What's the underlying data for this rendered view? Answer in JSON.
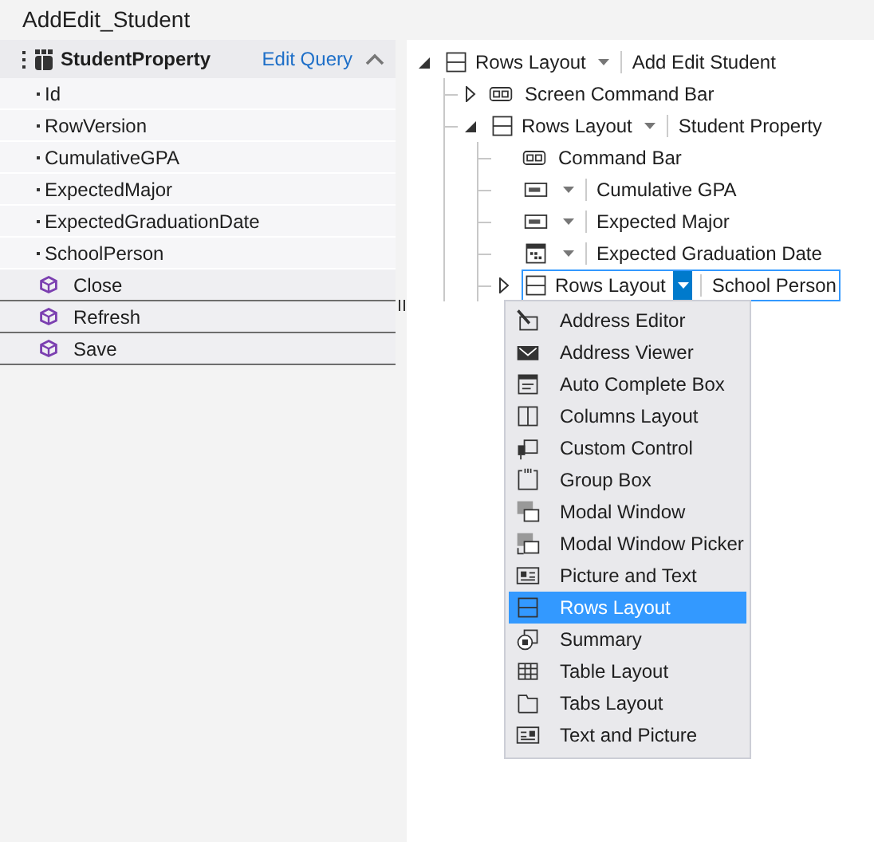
{
  "window": {
    "title": "AddEdit_Student"
  },
  "data_panel": {
    "title": "StudentProperty",
    "link": "Edit Query",
    "expanded": true,
    "properties": [
      "Id",
      "RowVersion",
      "CumulativeGPA",
      "ExpectedMajor",
      "ExpectedGraduationDate",
      "SchoolPerson"
    ],
    "methods": [
      "Close",
      "Refresh",
      "Save"
    ]
  },
  "tree": [
    {
      "kind": "layout",
      "control": "Rows Layout",
      "label": "Add Edit Student",
      "expanded": true,
      "selected": false,
      "children": [
        {
          "kind": "commandbar",
          "label": "Screen Command Bar",
          "expanded": false,
          "selected": false
        },
        {
          "kind": "layout",
          "control": "Rows Layout",
          "label": "Student Property",
          "expanded": true,
          "selected": false,
          "children": [
            {
              "kind": "commandbar",
              "label": "Command Bar",
              "selected": false
            },
            {
              "kind": "textbox",
              "label": "Cumulative GPA",
              "selected": false
            },
            {
              "kind": "textbox",
              "label": "Expected Major",
              "selected": false
            },
            {
              "kind": "datepicker",
              "label": "Expected Graduation Date",
              "selected": false
            },
            {
              "kind": "layout",
              "control": "Rows Layout",
              "label": "School Person",
              "expanded": false,
              "selected": true
            }
          ]
        }
      ]
    }
  ],
  "menu": [
    {
      "label": "Address Editor",
      "selected": false
    },
    {
      "label": "Address Viewer",
      "selected": false
    },
    {
      "label": "Auto Complete Box",
      "selected": false
    },
    {
      "label": "Columns Layout",
      "selected": false
    },
    {
      "label": "Custom Control",
      "selected": false
    },
    {
      "label": "Group Box",
      "selected": false
    },
    {
      "label": "Modal Window",
      "selected": false
    },
    {
      "label": "Modal Window Picker",
      "selected": false
    },
    {
      "label": "Picture and Text",
      "selected": false
    },
    {
      "label": "Rows Layout",
      "selected": true
    },
    {
      "label": "Summary",
      "selected": false
    },
    {
      "label": "Table Layout",
      "selected": false
    },
    {
      "label": "Tabs Layout",
      "selected": false
    },
    {
      "label": "Text and Picture",
      "selected": false
    }
  ]
}
